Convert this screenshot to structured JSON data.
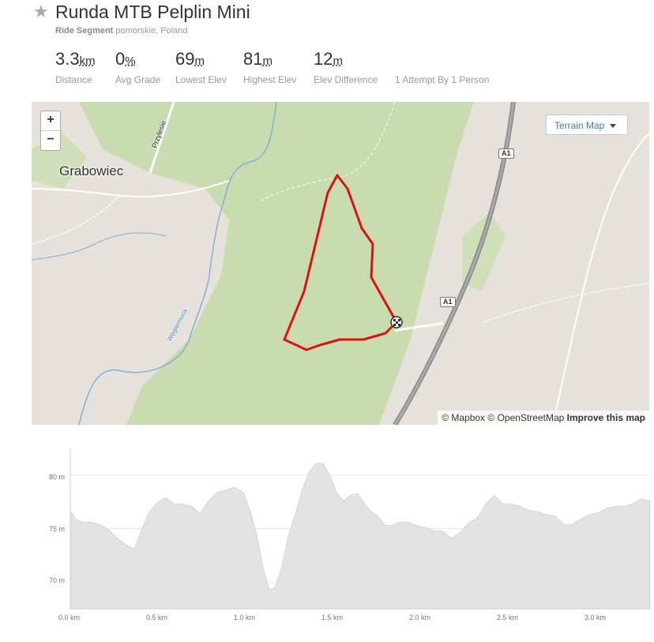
{
  "header": {
    "title": "Runda MTB Pelplin Mini",
    "segment_type": "Ride Segment",
    "location": "pomorskie, Poland",
    "star_icon": "star-icon"
  },
  "stats": [
    {
      "value": "3.3",
      "unit": "km",
      "label": "Distance"
    },
    {
      "value": "0",
      "unit": "%",
      "label": "Avg Grade"
    },
    {
      "value": "69",
      "unit": "m",
      "label": "Lowest Elev"
    },
    {
      "value": "81",
      "unit": "m",
      "label": "Highest Elev"
    },
    {
      "value": "12",
      "unit": "m",
      "label": "Elev Difference"
    }
  ],
  "attempts": "1 Attempt By 1 Person",
  "map": {
    "zoom_in": "+",
    "zoom_out": "−",
    "terrain_button": "Terrain Map",
    "place_label": "Grabowiec",
    "road_label_1": "Przylesie",
    "river_label": "Węgiermuca",
    "highway_shield": "A1",
    "attribution_mapbox": "© Mapbox",
    "attribution_osm": "© OpenStreetMap",
    "attribution_improve": "Improve this map",
    "route_color": "#dd1111",
    "forest_color": "#c8dcb0",
    "highway_color": "#888888"
  },
  "chart_data": {
    "type": "area",
    "xlabel": "",
    "ylabel": "",
    "xlim": [
      0,
      3.35
    ],
    "ylim": [
      67.5,
      82.5
    ],
    "x_ticks": [
      "0.0 km",
      "0.5 km",
      "1.0 km",
      "1.5 km",
      "2.0 km",
      "2.5 km",
      "3.0 km"
    ],
    "y_ticks": [
      "80 m",
      "75 m",
      "70 m"
    ],
    "grid": true,
    "series": [
      {
        "x": [
          0,
          0.03,
          0.07,
          0.12,
          0.17,
          0.22,
          0.27,
          0.32,
          0.37,
          0.41,
          0.45,
          0.5,
          0.55,
          0.6,
          0.65,
          0.7,
          0.75,
          0.8,
          0.85,
          0.9,
          0.95,
          1.0,
          1.04,
          1.08,
          1.11,
          1.15,
          1.18,
          1.22,
          1.26,
          1.3,
          1.34,
          1.38,
          1.42,
          1.46,
          1.5,
          1.54,
          1.58,
          1.62,
          1.66,
          1.7,
          1.74,
          1.78,
          1.82,
          1.86,
          1.9,
          1.95,
          2.0,
          2.05,
          2.1,
          2.15,
          2.2,
          2.25,
          2.3,
          2.35,
          2.4,
          2.45,
          2.5,
          2.55,
          2.6,
          2.65,
          2.7,
          2.75,
          2.8,
          2.85,
          2.9,
          2.95,
          3.0,
          3.05,
          3.1,
          3.15,
          3.2,
          3.25,
          3.3,
          3.35
        ],
        "values": [
          76.7,
          75.9,
          75.6,
          75.6,
          75.4,
          74.9,
          74.1,
          73.5,
          73.1,
          74.8,
          76.4,
          77.4,
          77.9,
          77.3,
          77.3,
          77.1,
          76.4,
          77.6,
          78.4,
          78.6,
          78.9,
          78.4,
          76.6,
          74.3,
          71.6,
          69.3,
          69.4,
          71.3,
          74.3,
          76.3,
          78.6,
          80.3,
          81.1,
          81.1,
          80.0,
          78.3,
          77.6,
          78.1,
          78.3,
          77.3,
          76.6,
          76.1,
          75.3,
          75.3,
          75.6,
          75.6,
          75.3,
          75.1,
          74.8,
          74.8,
          74.1,
          74.6,
          75.5,
          76.0,
          77.3,
          78.1,
          77.3,
          77.3,
          77.1,
          76.7,
          76.6,
          76.3,
          76.2,
          75.4,
          75.4,
          75.9,
          76.3,
          76.5,
          76.9,
          77.1,
          77.1,
          77.3,
          77.8,
          77.6
        ]
      }
    ]
  }
}
